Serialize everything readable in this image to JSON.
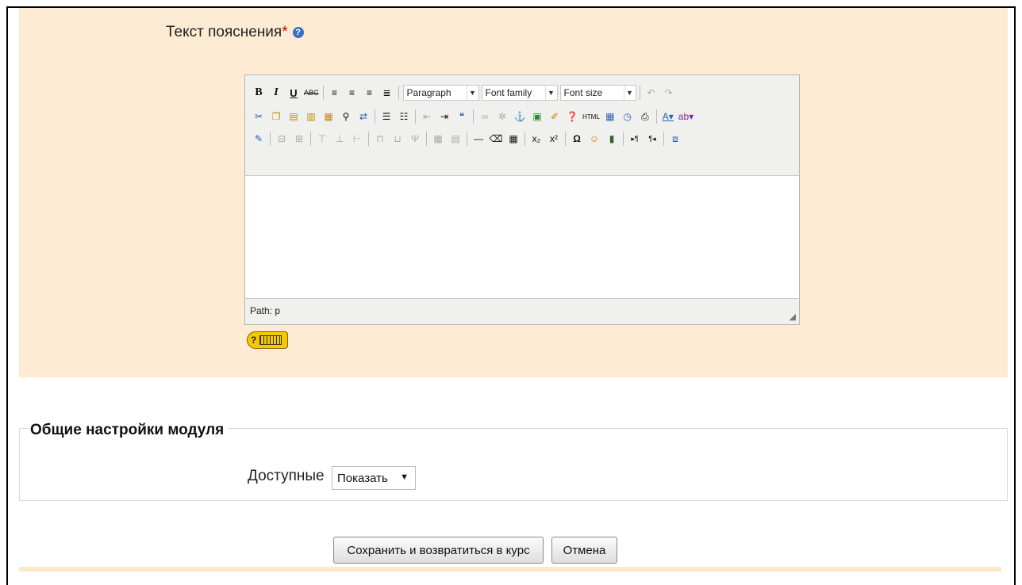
{
  "field": {
    "label": "Текст пояснения",
    "required_mark": "*",
    "help_icon": "help-icon"
  },
  "editor": {
    "formatting_buttons": [
      "B",
      "I",
      "U",
      "ABC"
    ],
    "dropdowns": {
      "format": "Paragraph",
      "font_family": "Font family",
      "font_size": "Font size"
    },
    "status_path": "Path: p",
    "resize_glyph": "◢",
    "toolbar_row2_icons": [
      "cut-icon",
      "copy-icon",
      "paste-icon",
      "paste-text-icon",
      "paste-word-icon",
      "find-icon",
      "replace-icon",
      "bullet-list-icon",
      "numbered-list-icon",
      "outdent-icon",
      "indent-icon",
      "blockquote-icon",
      "link-icon",
      "unlink-icon",
      "anchor-icon",
      "image-icon",
      "cleanup-icon",
      "help-icon",
      "html-icon",
      "insert-date-icon",
      "insert-time-icon",
      "preview-icon",
      "text-color-icon",
      "highlight-color-icon"
    ],
    "toolbar_row3_icons": [
      "edit-icon",
      "table-icon",
      "table-props-icon",
      "insert-row-icon",
      "delete-row-icon",
      "split-cells-icon",
      "merge-cells-icon",
      "hr-icon",
      "eraser-icon",
      "visual-aid-icon",
      "subscript-icon",
      "superscript-icon",
      "special-char-icon",
      "emoticon-icon",
      "media-icon",
      "ltr-icon",
      "rtl-icon",
      "fullscreen-icon"
    ]
  },
  "keyboard_help": {
    "icon": "keyboard-help-icon",
    "label": "?"
  },
  "module_settings": {
    "legend": "Общие настройки модуля",
    "visibility_label": "Доступные",
    "visibility_value": "Показать"
  },
  "buttons": {
    "save": "Сохранить и возвратиться в курс",
    "cancel": "Отмена"
  }
}
